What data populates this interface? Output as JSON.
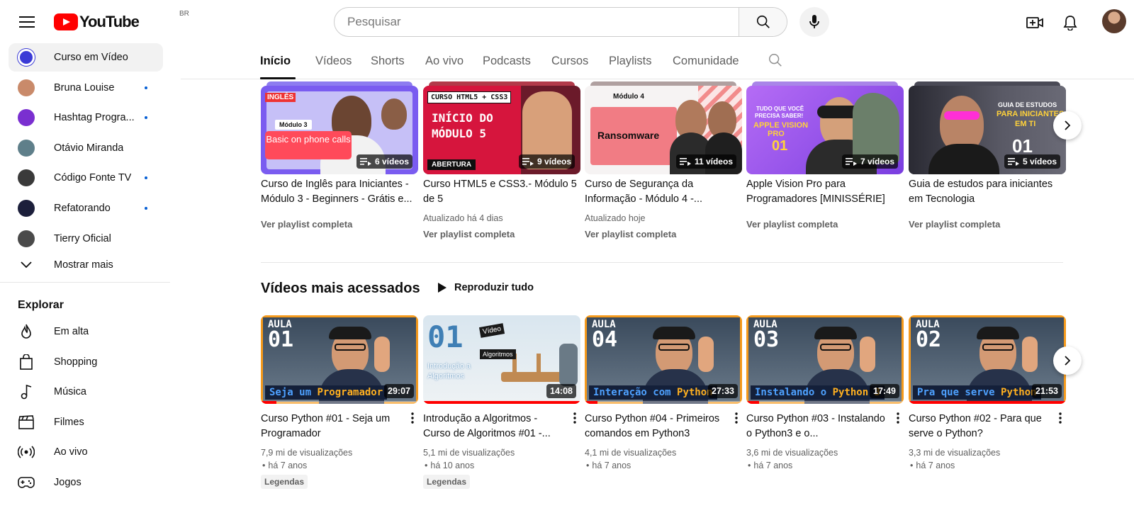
{
  "header": {
    "logo_text": "YouTube",
    "country_code": "BR",
    "search_placeholder": "Pesquisar"
  },
  "sidebar": {
    "subscriptions": [
      {
        "label": "Curso em Vídeo",
        "active": true,
        "new": false,
        "color": "#3b3bd6"
      },
      {
        "label": "Bruna Louise",
        "active": false,
        "new": true,
        "color": "#c98a6a"
      },
      {
        "label": "Hashtag Progra...",
        "active": false,
        "new": true,
        "color": "#7a2fd0"
      },
      {
        "label": "Otávio Miranda",
        "active": false,
        "new": false,
        "color": "#5f7f8a"
      },
      {
        "label": "Código Fonte TV",
        "active": false,
        "new": true,
        "color": "#3a3a3a"
      },
      {
        "label": "Refatorando",
        "active": false,
        "new": true,
        "color": "#1c1f3b"
      },
      {
        "label": "Tierry Oficial",
        "active": false,
        "new": false,
        "color": "#4a4a4a"
      }
    ],
    "show_more": "Mostrar mais",
    "explore_heading": "Explorar",
    "explore": [
      {
        "label": "Em alta",
        "icon": "trending-icon"
      },
      {
        "label": "Shopping",
        "icon": "shopping-bag-icon"
      },
      {
        "label": "Música",
        "icon": "music-note-icon"
      },
      {
        "label": "Filmes",
        "icon": "clapperboard-icon"
      },
      {
        "label": "Ao vivo",
        "icon": "live-icon"
      },
      {
        "label": "Jogos",
        "icon": "gamepad-icon"
      }
    ]
  },
  "tabs": [
    {
      "label": "Início",
      "active": true
    },
    {
      "label": "Vídeos",
      "active": false
    },
    {
      "label": "Shorts",
      "active": false
    },
    {
      "label": "Ao vivo",
      "active": false
    },
    {
      "label": "Podcasts",
      "active": false
    },
    {
      "label": "Cursos",
      "active": false
    },
    {
      "label": "Playlists",
      "active": false
    },
    {
      "label": "Comunidade",
      "active": false
    }
  ],
  "playlists": [
    {
      "title": "Curso de Inglês para Iniciantes - Módulo 3 - Beginners - Grátis e...",
      "count": "6 vídeos",
      "updated": "",
      "link": "Ver playlist completa",
      "thumb": {
        "module": "Módulo 3",
        "caption": "Basic on phone calls",
        "tag": "INGLÊS"
      }
    },
    {
      "title": "Curso HTML5 e CSS3.- Módulo 5 de 5",
      "count": "9 vídeos",
      "updated": "Atualizado há 4 dias",
      "link": "Ver playlist completa",
      "thumb": {
        "tag": "CURSO HTML5 + CSS3",
        "line1": "INÍCIO DO",
        "line2": "MÓDULO 5",
        "footer": "ABERTURA"
      }
    },
    {
      "title": "Curso de Segurança da Informação - Módulo 4 -...",
      "count": "11 vídeos",
      "updated": "Atualizado hoje",
      "link": "Ver playlist completa",
      "thumb": {
        "module": "Módulo 4",
        "caption": "Ransomware"
      }
    },
    {
      "title": "Apple Vision Pro para Programadores [MINISSÉRIE]",
      "count": "7 vídeos",
      "updated": "",
      "link": "Ver playlist completa",
      "thumb": {
        "line1": "TUDO QUE VOCÊ",
        "line2": "PRECISA SABER!",
        "line3": "APPLE VISION",
        "line4": "PRO",
        "number": "01"
      }
    },
    {
      "title": "Guia de estudos para iniciantes em Tecnologia",
      "count": "5 vídeos",
      "updated": "",
      "link": "Ver playlist completa",
      "thumb": {
        "line1": "GUIA DE ESTUDOS",
        "line2": "PARA INICIANTES",
        "line3": "EM TI",
        "number": "01"
      }
    }
  ],
  "section": {
    "title": "Vídeos mais acessados",
    "play_all": "Reproduzir tudo"
  },
  "videos": [
    {
      "title": "Curso Python #01 - Seja um Programador",
      "duration": "29:07",
      "views": "7,9 mi de visualizações",
      "age": "há 7 anos",
      "chip": "Legendas",
      "progress": 0.1,
      "thumb": {
        "aula": "AULA",
        "num": "01",
        "strip_a": "Seja um ",
        "strip_b": "Programador"
      }
    },
    {
      "title": "Introdução a Algoritmos - Curso de Algoritmos #01 -...",
      "duration": "14:08",
      "views": "5,1 mi de visualizações",
      "age": "há 10 anos",
      "chip": "Legendas",
      "progress": 1.0,
      "thumb": {
        "num": "01",
        "sub1": "Introdução a",
        "sub2": "Algoritmos",
        "tag1": "Vídeo",
        "tag2": "Algoritmos"
      }
    },
    {
      "title": "Curso Python #04 - Primeiros comandos em Python3",
      "duration": "27:33",
      "views": "4,1 mi de visualizações",
      "age": "há 7 anos",
      "chip": "",
      "progress": 0.08,
      "thumb": {
        "aula": "AULA",
        "num": "04",
        "strip_a": "Interação com ",
        "strip_b": "Python"
      }
    },
    {
      "title": "Curso Python #03 - Instalando o Python3 e o...",
      "duration": "17:49",
      "views": "3,6 mi de visualizações",
      "age": "há 7 anos",
      "chip": "",
      "progress": 0.08,
      "thumb": {
        "aula": "AULA",
        "num": "03",
        "strip_a": "Instalando o ",
        "strip_b": "Python 3"
      }
    },
    {
      "title": "Curso Python #02 - Para que serve o Python?",
      "duration": "21:53",
      "views": "3,3 mi de visualizações",
      "age": "há 7 anos",
      "chip": "",
      "progress": 1.0,
      "thumb": {
        "aula": "AULA",
        "num": "02",
        "strip_a": "Pra que serve ",
        "strip_b": "Python"
      }
    }
  ],
  "colors": {
    "brand_red": "#ff0000",
    "new_dot": "#065fd4",
    "text_primary": "#0f0f0f",
    "text_secondary": "#606060"
  }
}
